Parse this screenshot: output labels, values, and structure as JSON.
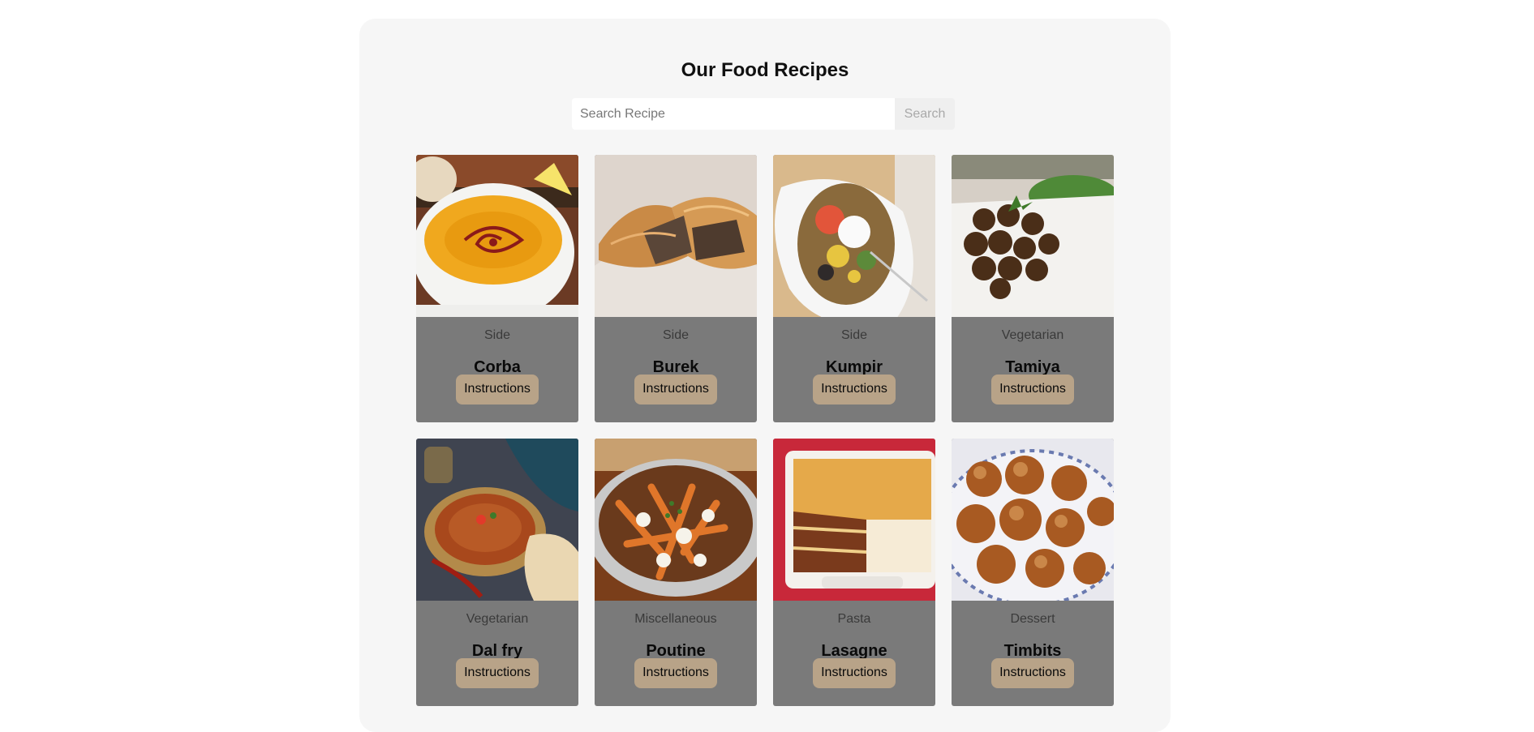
{
  "page": {
    "title": "Our Food Recipes"
  },
  "search": {
    "placeholder": "Search Recipe",
    "value": "",
    "button_label": "Search"
  },
  "recipes": [
    {
      "category": "Side",
      "name": "Corba",
      "button_label": "Instructions",
      "image": "lentil-soup-photo"
    },
    {
      "category": "Side",
      "name": "Burek",
      "button_label": "Instructions",
      "image": "meat-pastry-photo"
    },
    {
      "category": "Side",
      "name": "Kumpir",
      "button_label": "Instructions",
      "image": "stuffed-potato-photo"
    },
    {
      "category": "Vegetarian",
      "name": "Tamiya",
      "button_label": "Instructions",
      "image": "falafel-photo"
    },
    {
      "category": "Vegetarian",
      "name": "Dal fry",
      "button_label": "Instructions",
      "image": "dal-bowl-photo"
    },
    {
      "category": "Miscellaneous",
      "name": "Poutine",
      "button_label": "Instructions",
      "image": "poutine-photo"
    },
    {
      "category": "Pasta",
      "name": "Lasagne",
      "button_label": "Instructions",
      "image": "lasagne-photo"
    },
    {
      "category": "Dessert",
      "name": "Timbits",
      "button_label": "Instructions",
      "image": "timbits-photo"
    }
  ],
  "colors": {
    "page_background": "#ffffff",
    "panel_background": "#f6f6f6",
    "card_background": "#7a7a7a",
    "button_background": "#b8a388",
    "search_button_background": "#efefef"
  }
}
